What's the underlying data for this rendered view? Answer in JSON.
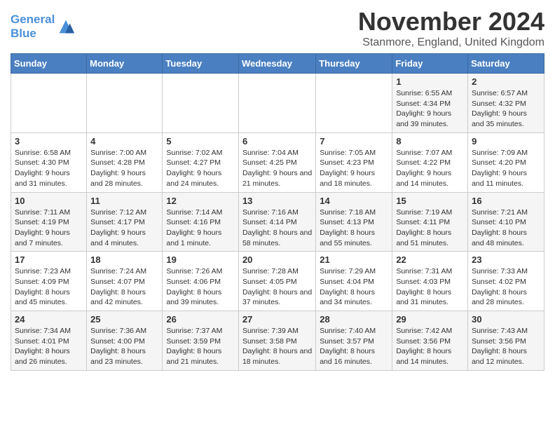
{
  "header": {
    "logo_line1": "General",
    "logo_line2": "Blue",
    "title": "November 2024",
    "subtitle": "Stanmore, England, United Kingdom"
  },
  "days_of_week": [
    "Sunday",
    "Monday",
    "Tuesday",
    "Wednesday",
    "Thursday",
    "Friday",
    "Saturday"
  ],
  "weeks": [
    [
      {
        "day": "",
        "info": ""
      },
      {
        "day": "",
        "info": ""
      },
      {
        "day": "",
        "info": ""
      },
      {
        "day": "",
        "info": ""
      },
      {
        "day": "",
        "info": ""
      },
      {
        "day": "1",
        "info": "Sunrise: 6:55 AM\nSunset: 4:34 PM\nDaylight: 9 hours and 39 minutes."
      },
      {
        "day": "2",
        "info": "Sunrise: 6:57 AM\nSunset: 4:32 PM\nDaylight: 9 hours and 35 minutes."
      }
    ],
    [
      {
        "day": "3",
        "info": "Sunrise: 6:58 AM\nSunset: 4:30 PM\nDaylight: 9 hours and 31 minutes."
      },
      {
        "day": "4",
        "info": "Sunrise: 7:00 AM\nSunset: 4:28 PM\nDaylight: 9 hours and 28 minutes."
      },
      {
        "day": "5",
        "info": "Sunrise: 7:02 AM\nSunset: 4:27 PM\nDaylight: 9 hours and 24 minutes."
      },
      {
        "day": "6",
        "info": "Sunrise: 7:04 AM\nSunset: 4:25 PM\nDaylight: 9 hours and 21 minutes."
      },
      {
        "day": "7",
        "info": "Sunrise: 7:05 AM\nSunset: 4:23 PM\nDaylight: 9 hours and 18 minutes."
      },
      {
        "day": "8",
        "info": "Sunrise: 7:07 AM\nSunset: 4:22 PM\nDaylight: 9 hours and 14 minutes."
      },
      {
        "day": "9",
        "info": "Sunrise: 7:09 AM\nSunset: 4:20 PM\nDaylight: 9 hours and 11 minutes."
      }
    ],
    [
      {
        "day": "10",
        "info": "Sunrise: 7:11 AM\nSunset: 4:19 PM\nDaylight: 9 hours and 7 minutes."
      },
      {
        "day": "11",
        "info": "Sunrise: 7:12 AM\nSunset: 4:17 PM\nDaylight: 9 hours and 4 minutes."
      },
      {
        "day": "12",
        "info": "Sunrise: 7:14 AM\nSunset: 4:16 PM\nDaylight: 9 hours and 1 minute."
      },
      {
        "day": "13",
        "info": "Sunrise: 7:16 AM\nSunset: 4:14 PM\nDaylight: 8 hours and 58 minutes."
      },
      {
        "day": "14",
        "info": "Sunrise: 7:18 AM\nSunset: 4:13 PM\nDaylight: 8 hours and 55 minutes."
      },
      {
        "day": "15",
        "info": "Sunrise: 7:19 AM\nSunset: 4:11 PM\nDaylight: 8 hours and 51 minutes."
      },
      {
        "day": "16",
        "info": "Sunrise: 7:21 AM\nSunset: 4:10 PM\nDaylight: 8 hours and 48 minutes."
      }
    ],
    [
      {
        "day": "17",
        "info": "Sunrise: 7:23 AM\nSunset: 4:09 PM\nDaylight: 8 hours and 45 minutes."
      },
      {
        "day": "18",
        "info": "Sunrise: 7:24 AM\nSunset: 4:07 PM\nDaylight: 8 hours and 42 minutes."
      },
      {
        "day": "19",
        "info": "Sunrise: 7:26 AM\nSunset: 4:06 PM\nDaylight: 8 hours and 39 minutes."
      },
      {
        "day": "20",
        "info": "Sunrise: 7:28 AM\nSunset: 4:05 PM\nDaylight: 8 hours and 37 minutes."
      },
      {
        "day": "21",
        "info": "Sunrise: 7:29 AM\nSunset: 4:04 PM\nDaylight: 8 hours and 34 minutes."
      },
      {
        "day": "22",
        "info": "Sunrise: 7:31 AM\nSunset: 4:03 PM\nDaylight: 8 hours and 31 minutes."
      },
      {
        "day": "23",
        "info": "Sunrise: 7:33 AM\nSunset: 4:02 PM\nDaylight: 8 hours and 28 minutes."
      }
    ],
    [
      {
        "day": "24",
        "info": "Sunrise: 7:34 AM\nSunset: 4:01 PM\nDaylight: 8 hours and 26 minutes."
      },
      {
        "day": "25",
        "info": "Sunrise: 7:36 AM\nSunset: 4:00 PM\nDaylight: 8 hours and 23 minutes."
      },
      {
        "day": "26",
        "info": "Sunrise: 7:37 AM\nSunset: 3:59 PM\nDaylight: 8 hours and 21 minutes."
      },
      {
        "day": "27",
        "info": "Sunrise: 7:39 AM\nSunset: 3:58 PM\nDaylight: 8 hours and 18 minutes."
      },
      {
        "day": "28",
        "info": "Sunrise: 7:40 AM\nSunset: 3:57 PM\nDaylight: 8 hours and 16 minutes."
      },
      {
        "day": "29",
        "info": "Sunrise: 7:42 AM\nSunset: 3:56 PM\nDaylight: 8 hours and 14 minutes."
      },
      {
        "day": "30",
        "info": "Sunrise: 7:43 AM\nSunset: 3:56 PM\nDaylight: 8 hours and 12 minutes."
      }
    ]
  ]
}
